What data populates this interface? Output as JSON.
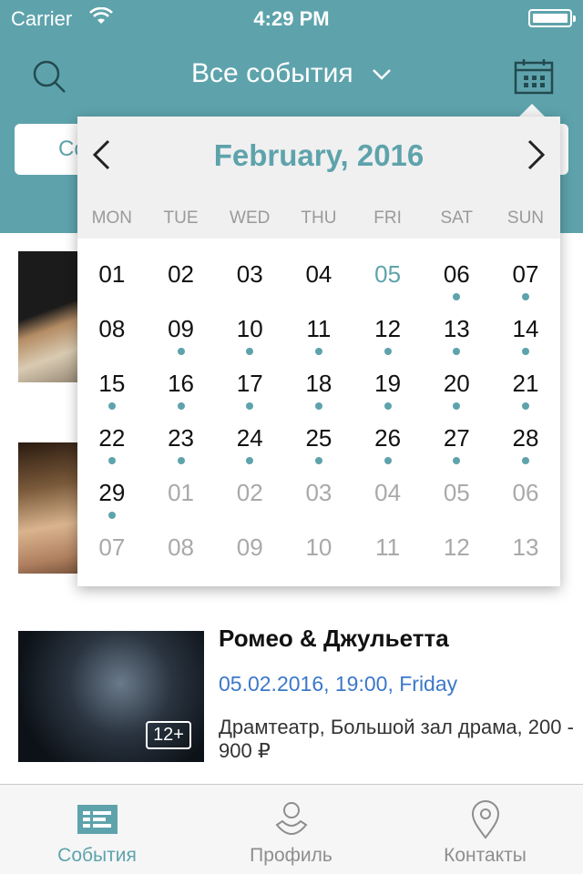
{
  "status_bar": {
    "carrier": "Carrier",
    "time": "4:29 PM"
  },
  "header": {
    "title": "Все события"
  },
  "search": {
    "placeholder_visible": "Со"
  },
  "event": {
    "title": "Ромео & Джульетта",
    "date": "05.02.2016, 19:00, Friday",
    "venue": "Драмтеатр, Большой зал драма, 200 - 900 ₽",
    "age": "12+"
  },
  "calendar": {
    "month": "February, 2016",
    "weekdays": [
      "MON",
      "TUE",
      "WED",
      "THU",
      "FRI",
      "SAT",
      "SUN"
    ],
    "days": [
      {
        "label": "01",
        "state": "current",
        "event": false
      },
      {
        "label": "02",
        "state": "current",
        "event": false
      },
      {
        "label": "03",
        "state": "current",
        "event": false
      },
      {
        "label": "04",
        "state": "current",
        "event": false
      },
      {
        "label": "05",
        "state": "today",
        "event": false
      },
      {
        "label": "06",
        "state": "current",
        "event": true
      },
      {
        "label": "07",
        "state": "current",
        "event": true
      },
      {
        "label": "08",
        "state": "current",
        "event": false
      },
      {
        "label": "09",
        "state": "current",
        "event": true
      },
      {
        "label": "10",
        "state": "current",
        "event": true
      },
      {
        "label": "11",
        "state": "current",
        "event": true
      },
      {
        "label": "12",
        "state": "current",
        "event": true
      },
      {
        "label": "13",
        "state": "current",
        "event": true
      },
      {
        "label": "14",
        "state": "current",
        "event": true
      },
      {
        "label": "15",
        "state": "current",
        "event": true
      },
      {
        "label": "16",
        "state": "current",
        "event": true
      },
      {
        "label": "17",
        "state": "current",
        "event": true
      },
      {
        "label": "18",
        "state": "current",
        "event": true
      },
      {
        "label": "19",
        "state": "current",
        "event": true
      },
      {
        "label": "20",
        "state": "current",
        "event": true
      },
      {
        "label": "21",
        "state": "current",
        "event": true
      },
      {
        "label": "22",
        "state": "current",
        "event": true
      },
      {
        "label": "23",
        "state": "current",
        "event": true
      },
      {
        "label": "24",
        "state": "current",
        "event": true
      },
      {
        "label": "25",
        "state": "current",
        "event": true
      },
      {
        "label": "26",
        "state": "current",
        "event": true
      },
      {
        "label": "27",
        "state": "current",
        "event": true
      },
      {
        "label": "28",
        "state": "current",
        "event": true
      },
      {
        "label": "29",
        "state": "current",
        "event": true
      },
      {
        "label": "01",
        "state": "other",
        "event": false
      },
      {
        "label": "02",
        "state": "other",
        "event": false
      },
      {
        "label": "03",
        "state": "other",
        "event": false
      },
      {
        "label": "04",
        "state": "other",
        "event": false
      },
      {
        "label": "05",
        "state": "other",
        "event": false
      },
      {
        "label": "06",
        "state": "other",
        "event": false
      },
      {
        "label": "07",
        "state": "other",
        "event": false
      },
      {
        "label": "08",
        "state": "other",
        "event": false
      },
      {
        "label": "09",
        "state": "other",
        "event": false
      },
      {
        "label": "10",
        "state": "other",
        "event": false
      },
      {
        "label": "11",
        "state": "other",
        "event": false
      },
      {
        "label": "12",
        "state": "other",
        "event": false
      },
      {
        "label": "13",
        "state": "other",
        "event": false
      }
    ]
  },
  "tabbar": {
    "tabs": [
      {
        "label": "События",
        "icon": "list-icon",
        "active": true
      },
      {
        "label": "Профиль",
        "icon": "profile-icon",
        "active": false
      },
      {
        "label": "Контакты",
        "icon": "location-pin-icon",
        "active": false
      }
    ]
  },
  "colors": {
    "accent": "#5ea3ac",
    "date_link": "#3b78c8"
  }
}
